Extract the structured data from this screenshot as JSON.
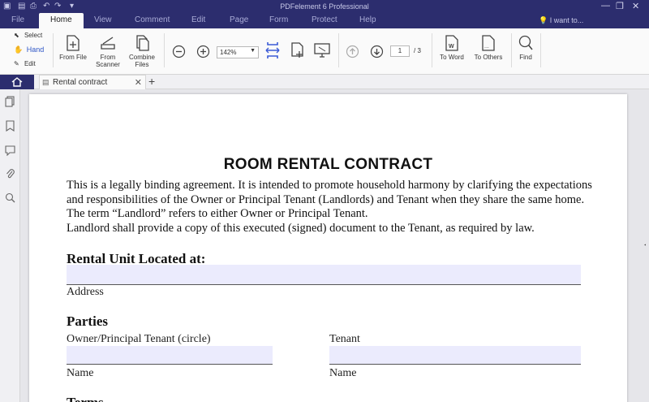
{
  "app": {
    "title": "PDFelement 6 Professional"
  },
  "menu": {
    "tabs": [
      {
        "label": "File"
      },
      {
        "label": "Home"
      },
      {
        "label": "View"
      },
      {
        "label": "Comment"
      },
      {
        "label": "Edit"
      },
      {
        "label": "Page"
      },
      {
        "label": "Form"
      },
      {
        "label": "Protect"
      },
      {
        "label": "Help"
      }
    ],
    "search_label": "I want to..."
  },
  "ribbon": {
    "select": "Select",
    "hand": "Hand",
    "edit": "Edit",
    "from_file": "From File",
    "from_scanner": "From Scanner",
    "combine_files": "Combine Files",
    "zoom_value": "142%",
    "page_current": "1",
    "page_total": "/ 3",
    "to_word": "To Word",
    "to_others": "To Others",
    "find": "Find"
  },
  "tabs": {
    "doc_tab": "Rental contract"
  },
  "document": {
    "title": "ROOM RENTAL CONTRACT",
    "intro": "This is a legally binding agreement.  It is intended to promote household harmony by clarifying the expectations and responsibilities of the Owner or Principal Tenant (Landlords) and Tenant when they share the same home.  The term “Landlord” refers to either Owner or Principal Tenant.",
    "intro2": "Landlord shall provide a copy of this executed (signed) document to the Tenant, as required by law.",
    "section_rental_unit": "Rental Unit Located at:",
    "address_label": "Address",
    "section_parties": "Parties",
    "owner_label": "Owner/Principal Tenant (circle)",
    "tenant_label": "Tenant",
    "name_label_1": "Name",
    "name_label_2": "Name",
    "section_terms": "Terms"
  },
  "colors": {
    "brand": "#2c2d6e",
    "field_fill": "#ebebfd",
    "accent_icon": "#3b5bd6"
  }
}
